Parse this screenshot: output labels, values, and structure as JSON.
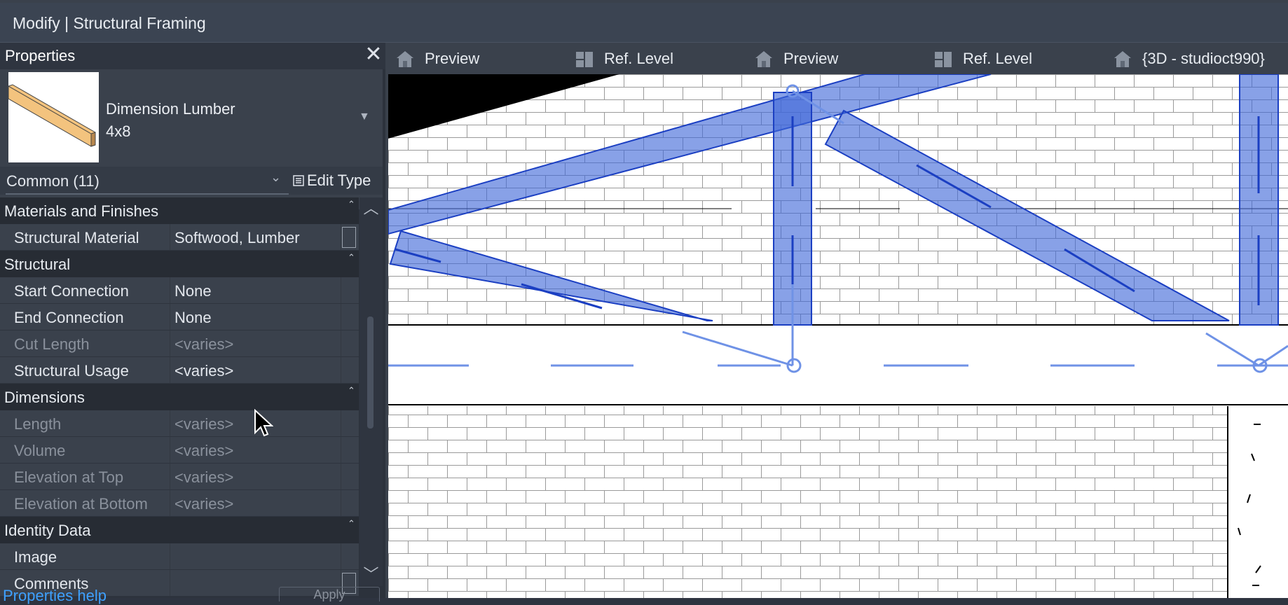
{
  "window": {
    "title": "Modify | Structural Framing"
  },
  "properties": {
    "title": "Properties",
    "type_family": "Dimension Lumber",
    "type_size": "4x8",
    "filter": "Common (11)",
    "edit_type_label": "Edit Type",
    "help_link": "Properties help",
    "apply_label": "Apply",
    "groups": [
      {
        "name": "Materials and Finishes",
        "rows": [
          {
            "name": "Structural Material",
            "value": "Softwood, Lumber"
          }
        ]
      },
      {
        "name": "Structural",
        "rows": [
          {
            "name": "Start Connection",
            "value": "None"
          },
          {
            "name": "End Connection",
            "value": "None"
          },
          {
            "name": "Cut Length",
            "value": "<varies>"
          },
          {
            "name": "Structural Usage",
            "value": "<varies>"
          }
        ]
      },
      {
        "name": "Dimensions",
        "rows": [
          {
            "name": "Length",
            "value": "<varies>"
          },
          {
            "name": "Volume",
            "value": "<varies>"
          },
          {
            "name": "Elevation at Top",
            "value": "<varies>"
          },
          {
            "name": "Elevation at Bottom",
            "value": "<varies>"
          }
        ]
      },
      {
        "name": "Identity Data",
        "rows": [
          {
            "name": "Image",
            "value": ""
          },
          {
            "name": "Comments",
            "value": ""
          }
        ]
      }
    ]
  },
  "view_tabs": [
    {
      "label": "Preview",
      "icon": "house-icon"
    },
    {
      "label": "Ref. Level",
      "icon": "level-icon"
    },
    {
      "label": "Preview",
      "icon": "house-icon"
    },
    {
      "label": "Ref. Level",
      "icon": "level-icon"
    },
    {
      "label": "{3D - studioct990}",
      "icon": "house-icon"
    }
  ],
  "colors": {
    "selection_blue": "#3f68d8",
    "panel_bg": "#3a414c",
    "link": "#3ea1ff"
  }
}
